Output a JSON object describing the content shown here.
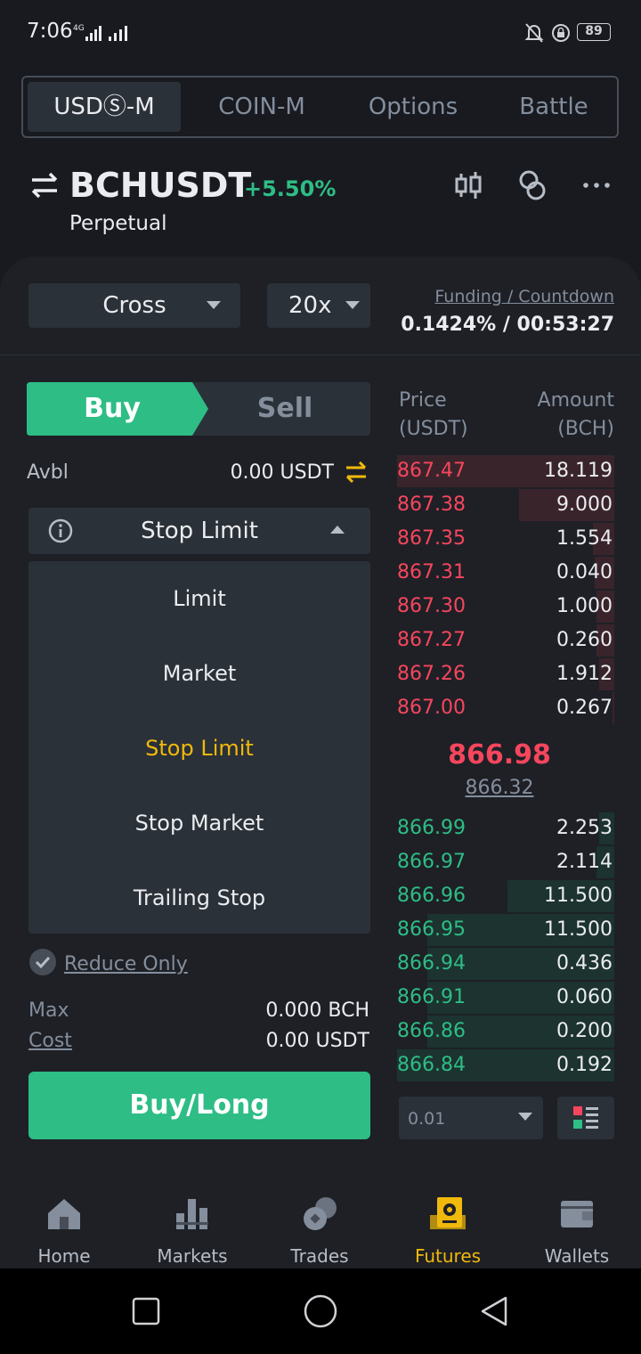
{
  "status_bar": {
    "time": "7:06",
    "signal_label": "4G",
    "battery": "89"
  },
  "tabs": [
    {
      "label": "USDⓈ-M",
      "active": true
    },
    {
      "label": "COIN-M",
      "active": false
    },
    {
      "label": "Options",
      "active": false
    },
    {
      "label": "Battle",
      "active": false
    }
  ],
  "symbol": {
    "name": "BCHUSDT",
    "change": "+5.50%",
    "type": "Perpetual"
  },
  "controls": {
    "margin_mode": "Cross",
    "leverage": "20x",
    "funding_label": "Funding / Countdown",
    "funding_value": "0.1424% / 00:53:27"
  },
  "order": {
    "buy_label": "Buy",
    "sell_label": "Sell",
    "avbl_label": "Avbl",
    "avbl_value": "0.00 USDT",
    "order_type": "Stop Limit",
    "menu": [
      "Limit",
      "Market",
      "Stop Limit",
      "Stop Market",
      "Trailing Stop"
    ],
    "menu_selected": "Stop Limit",
    "reduce_only": "Reduce Only",
    "max_label": "Max",
    "max_value": "0.000 BCH",
    "cost_label": "Cost",
    "cost_value": "0.00 USDT",
    "submit_label": "Buy/Long"
  },
  "orderbook": {
    "price_header": [
      "Price",
      "(USDT)"
    ],
    "amount_header": [
      "Amount",
      "(BCH)"
    ],
    "asks": [
      {
        "price": "867.47",
        "amount": "18.119",
        "depth": 1.0
      },
      {
        "price": "867.38",
        "amount": "9.000",
        "depth": 0.44
      },
      {
        "price": "867.35",
        "amount": "1.554",
        "depth": 0.1
      },
      {
        "price": "867.31",
        "amount": "0.040",
        "depth": 0.09
      },
      {
        "price": "867.30",
        "amount": "1.000",
        "depth": 0.08
      },
      {
        "price": "867.27",
        "amount": "0.260",
        "depth": 0.08
      },
      {
        "price": "867.26",
        "amount": "1.912",
        "depth": 0.07
      },
      {
        "price": "867.00",
        "amount": "0.267",
        "depth": 0.01
      }
    ],
    "last_price": "866.98",
    "mark_price": "866.32",
    "bids": [
      {
        "price": "866.99",
        "amount": "2.253",
        "depth": 0.07
      },
      {
        "price": "866.97",
        "amount": "2.114",
        "depth": 0.08
      },
      {
        "price": "866.96",
        "amount": "11.500",
        "depth": 0.49
      },
      {
        "price": "866.95",
        "amount": "11.500",
        "depth": 0.86
      },
      {
        "price": "866.94",
        "amount": "0.436",
        "depth": 0.86
      },
      {
        "price": "866.91",
        "amount": "0.060",
        "depth": 0.86
      },
      {
        "price": "866.86",
        "amount": "0.200",
        "depth": 0.86
      },
      {
        "price": "866.84",
        "amount": "0.192",
        "depth": 1.0
      }
    ],
    "precision": "0.01"
  },
  "bottom_nav": [
    {
      "label": "Home",
      "icon": "home-icon",
      "active": false
    },
    {
      "label": "Markets",
      "icon": "markets-icon",
      "active": false
    },
    {
      "label": "Trades",
      "icon": "trades-icon",
      "active": false
    },
    {
      "label": "Futures",
      "icon": "futures-icon",
      "active": true
    },
    {
      "label": "Wallets",
      "icon": "wallets-icon",
      "active": false
    }
  ],
  "colors": {
    "accent": "#f0b90b",
    "buy": "#2ebd85",
    "sell": "#f6465d",
    "background": "#181a20"
  }
}
